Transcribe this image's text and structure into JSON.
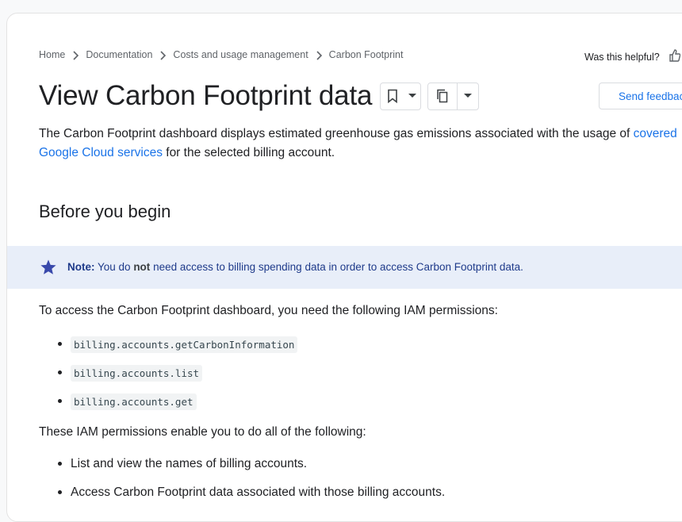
{
  "breadcrumb": {
    "items": [
      "Home",
      "Documentation",
      "Costs and usage management",
      "Carbon Footprint"
    ]
  },
  "helpful": {
    "label": "Was this helpful?"
  },
  "page": {
    "title": "View Carbon Footprint data"
  },
  "send_feedback": {
    "label": "Send feedback"
  },
  "intro": {
    "before_link": "The Carbon Footprint dashboard displays estimated greenhouse gas emissions associated with the usage of ",
    "link_text": "covered Google Cloud services",
    "after_link": " for the selected billing account."
  },
  "section": {
    "heading": "Before you begin"
  },
  "note": {
    "label": "Note:",
    "part1": " You do ",
    "bold": "not",
    "part2": " need access to billing spending data in order to access Carbon Footprint data."
  },
  "permissions_intro": "To access the Carbon Footprint dashboard, you need the following IAM permissions:",
  "permissions": [
    "billing.accounts.getCarbonInformation",
    "billing.accounts.list",
    "billing.accounts.get"
  ],
  "actions_intro": "These IAM permissions enable you to do all of the following:",
  "actions": [
    "List and view the names of billing accounts.",
    "Access Carbon Footprint data associated with those billing accounts."
  ],
  "colors": {
    "link": "#1a73e8",
    "note_bg": "#e8eef9",
    "note_accent": "#3949ab"
  }
}
